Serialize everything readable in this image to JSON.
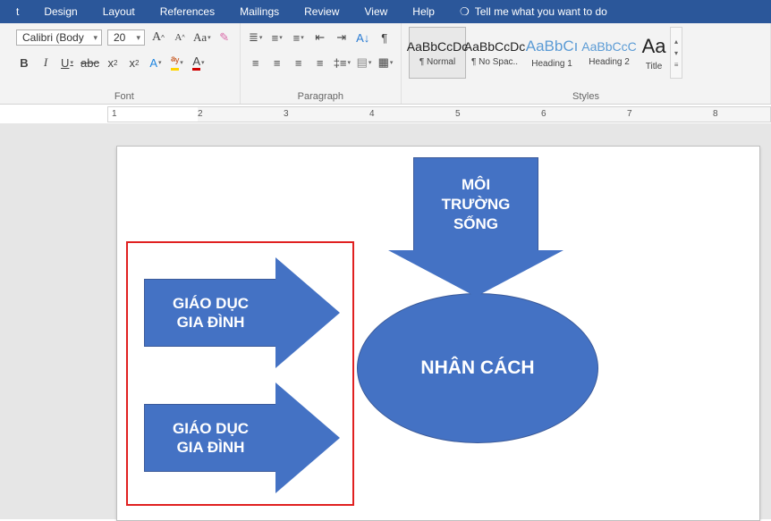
{
  "menu": {
    "items": [
      "t",
      "Design",
      "Layout",
      "References",
      "Mailings",
      "Review",
      "View",
      "Help"
    ],
    "tellme": "Tell me what you want to do"
  },
  "font": {
    "name": "Calibri (Body",
    "size": "20",
    "group_label": "Font"
  },
  "paragraph": {
    "group_label": "Paragraph"
  },
  "styles": {
    "group_label": "Styles",
    "items": [
      {
        "preview": "AaBbCcDc",
        "name": "¶ Normal",
        "blue": false,
        "selected": true,
        "large": false
      },
      {
        "preview": "AaBbCcDc",
        "name": "¶ No Spac..",
        "blue": false,
        "selected": false,
        "large": false
      },
      {
        "preview": "AaBbCı",
        "name": "Heading 1",
        "blue": true,
        "selected": false,
        "large": true
      },
      {
        "preview": "AaBbCcC",
        "name": "Heading 2",
        "blue": true,
        "selected": false,
        "large": false
      },
      {
        "preview": "Aa",
        "name": "Title",
        "blue": false,
        "selected": false,
        "large": true
      }
    ]
  },
  "ruler": {
    "nums": [
      "1",
      "2",
      "3",
      "4",
      "5",
      "6",
      "7",
      "8"
    ]
  },
  "shapes": {
    "oval": "NHÂN CÁCH",
    "arrow1": [
      "GIÁO DỤC",
      "GIA ĐÌNH"
    ],
    "arrow2": [
      "GIÁO DỤC",
      "GIA ĐÌNH"
    ],
    "down": [
      "MÔI",
      "TRƯỜNG",
      "SỐNG"
    ]
  }
}
